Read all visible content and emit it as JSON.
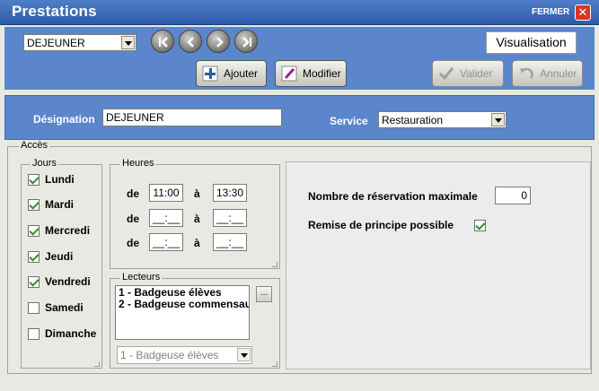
{
  "window": {
    "title": "Prestations",
    "close_label": "FERMER",
    "close_glyph": "✕"
  },
  "header": {
    "prestation_select": "DEJEUNER",
    "mode_label": "Visualisation",
    "buttons": {
      "ajouter": "Ajouter",
      "modifier": "Modifier",
      "valider": "Valider",
      "annuler": "Annuler"
    },
    "nav_icons": [
      "first-record-icon",
      "previous-record-icon",
      "next-record-icon",
      "last-record-icon"
    ]
  },
  "designation": {
    "label": "Désignation",
    "value": "DEJEUNER",
    "service_label": "Service",
    "service_value": "Restauration"
  },
  "acces": {
    "legend": "Accès",
    "jours": {
      "legend": "Jours",
      "days": [
        {
          "label": "Lundi",
          "checked": true
        },
        {
          "label": "Mardi",
          "checked": true
        },
        {
          "label": "Mercredi",
          "checked": true
        },
        {
          "label": "Jeudi",
          "checked": true
        },
        {
          "label": "Vendredi",
          "checked": true
        },
        {
          "label": "Samedi",
          "checked": false
        },
        {
          "label": "Dimanche",
          "checked": false
        }
      ]
    },
    "heures": {
      "legend": "Heures",
      "de_label": "de",
      "a_label": "à",
      "rows": [
        {
          "from": "11:00",
          "to": "13:30"
        },
        {
          "from": "__:__",
          "to": "__:__"
        },
        {
          "from": "__:__",
          "to": "__:__"
        }
      ]
    },
    "lecteurs": {
      "legend": "Lecteurs",
      "items": [
        "1 - Badgeuse élèves",
        "2 - Badgeuse commensau"
      ],
      "button_label": "...",
      "selected": "1 - Badgeuse élèves"
    },
    "options": {
      "max_reservations_label": "Nombre de réservation maximale",
      "max_reservations_value": "0",
      "remise_label": "Remise de principe possible",
      "remise_checked": true
    }
  },
  "colors": {
    "title_bar": "#3a68b5",
    "panel_blue": "#5b86cc",
    "background": "#e9e9e4",
    "close_red": "#d9352a",
    "check_green": "#2f8f2f"
  }
}
